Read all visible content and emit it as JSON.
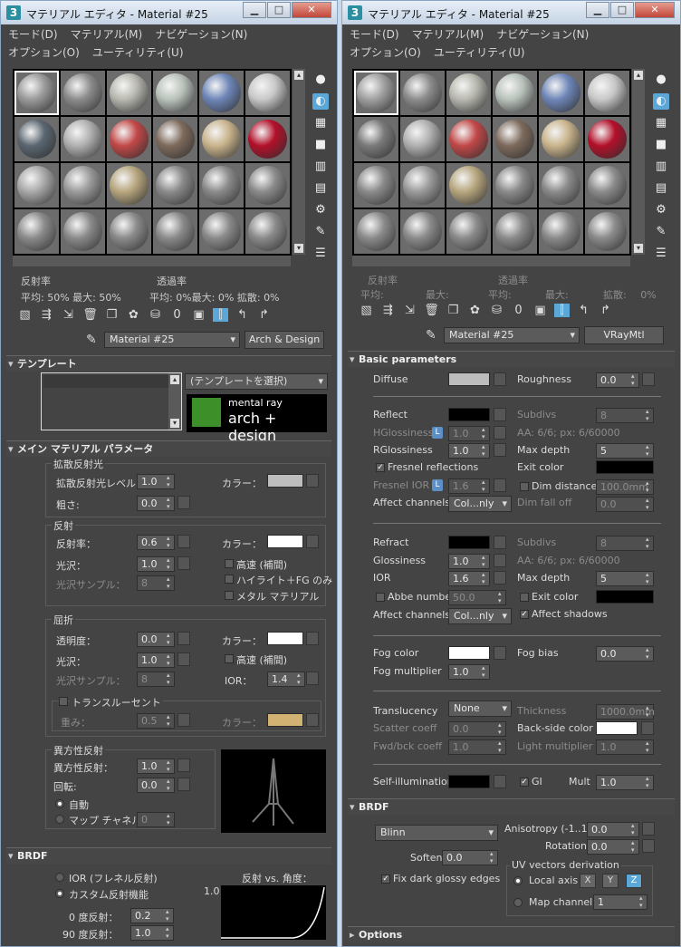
{
  "left": {
    "title": "マテリアル エディタ - Material #25",
    "menu": [
      "モード(D)",
      "マテリアル(M)",
      "ナビゲーション(N)",
      "オプション(O)",
      "ユーティリティ(U)"
    ],
    "info": {
      "reflect": "反射率",
      "transmit": "透過率",
      "avg1": "平均:",
      "avg1_val": "50%",
      "max1": "最大:",
      "max1_val": "50%",
      "avg2": "平均:",
      "avg2_val": "0%",
      "max2": "最大:",
      "max2_val": "0%",
      "diffuse": "拡散:",
      "diffuse_val": "0%"
    },
    "material_name": "Material #25",
    "material_type": "Arch & Design",
    "template": {
      "heading": "テンプレート",
      "select": "(テンプレートを選択)",
      "brand_small": "mental ray",
      "brand_big": "arch + design"
    },
    "main": {
      "heading": "メイン マテリアル パラメータ",
      "diffuse": {
        "title": "拡散反射光",
        "level_label": "拡散反射光レベル",
        "level": "1.0",
        "color_label": "カラー：",
        "rough_label": "粗さ:",
        "rough": "0.0"
      },
      "reflection": {
        "title": "反射",
        "refl_label": "反射率：",
        "refl": "0.6",
        "color_label": "カラー：",
        "gloss_label": "光沢：",
        "gloss": "1.0",
        "samples_label": "光沢サンプル：",
        "samples": "8",
        "fast": "高速 (補間)",
        "highlight": "ハイライト＋FG のみ",
        "metal": "メタル マテリアル"
      },
      "refraction": {
        "title": "屈折",
        "trans_label": "透明度：",
        "trans": "0.0",
        "color_label": "カラー：",
        "gloss_label": "光沢：",
        "gloss": "1.0",
        "samples_label": "光沢サンプル：",
        "samples": "8",
        "fast": "高速 (補間)",
        "ior_label": "IOR：",
        "ior": "1.4",
        "translucency": "トランスルーセント",
        "weight_label": "重み：",
        "weight": "0.5",
        "color2_label": "カラー："
      },
      "aniso": {
        "title": "異方性反射",
        "aniso_label": "異方性反射：",
        "aniso": "1.0",
        "rot_label": "回転:",
        "rot": "0.0",
        "auto": "自動",
        "map_ch": "マップ チャネル",
        "map_ch_val": "0"
      }
    },
    "brdf": {
      "heading": "BRDF",
      "ior_opt": "IOR (フレネル反射)",
      "custom_opt": "カスタム反射機能",
      "graph_title": "反射 vs. 角度：",
      "graph_y": "1.0",
      "deg0": "0 度反射：",
      "deg0_val": "0.2",
      "deg90": "90 度反射：",
      "deg90_val": "1.0"
    }
  },
  "right": {
    "title": "マテリアル エディタ - Material #25",
    "menu": [
      "モード(D)",
      "マテリアル(M)",
      "ナビゲーション(N)",
      "オプション(O)",
      "ユーティリティ(U)"
    ],
    "info": {
      "reflect": "反射率",
      "transmit": "透過率",
      "avg1": "平均:",
      "max1": "最大:",
      "avg2": "平均:",
      "max2": "最大:",
      "diffuse": "拡散:",
      "diffuse_val": "0%"
    },
    "material_name": "Material #25",
    "material_type": "VRayMtl",
    "basic": {
      "heading": "Basic parameters",
      "diffuse": "Diffuse",
      "roughness": "Roughness",
      "roughness_val": "0.0",
      "reflect": "Reflect",
      "subdivs": "Subdivs",
      "subdivs_val": "8",
      "hgloss": "HGlossiness",
      "hgloss_val": "1.0",
      "aa": "AA: 6/6; px: 6/60000",
      "rgloss": "RGlossiness",
      "rgloss_val": "1.0",
      "maxdepth": "Max depth",
      "maxdepth_val": "5",
      "fresnel": "Fresnel reflections",
      "exitcolor": "Exit color",
      "fresnel_ior": "Fresnel IOR",
      "fresnel_ior_val": "1.6",
      "dimdist": "Dim distance",
      "dimdist_val": "100.0mm",
      "affect": "Affect channels",
      "affect_val": "Col...nly",
      "dimfall": "Dim fall off",
      "dimfall_val": "0.0",
      "refract": "Refract",
      "rsubdivs": "Subdivs",
      "rsubdivs_val": "8",
      "gloss": "Glossiness",
      "gloss_val": "1.0",
      "raa": "AA: 6/6; px: 6/60000",
      "ior": "IOR",
      "ior_val": "1.6",
      "rmaxdepth": "Max depth",
      "rmaxdepth_val": "5",
      "abbe": "Abbe number",
      "abbe_val": "50.0",
      "rexit": "Exit color",
      "raffect": "Affect channels",
      "raffect_val": "Col...nly",
      "shadows": "Affect shadows",
      "fogcolor": "Fog color",
      "fogbias": "Fog bias",
      "fogbias_val": "0.0",
      "fogmult": "Fog multiplier",
      "fogmult_val": "1.0",
      "transl": "Translucency",
      "transl_val": "None",
      "thick": "Thickness",
      "thick_val": "1000.0mm",
      "scatter": "Scatter coeff",
      "scatter_val": "0.0",
      "backside": "Back-side color",
      "fwd": "Fwd/bck coeff",
      "fwd_val": "1.0",
      "lightmult": "Light multiplier",
      "lightmult_val": "1.0",
      "selfillum": "Self-illumination",
      "gi": "GI",
      "mult": "Mult",
      "mult_val": "1.0"
    },
    "brdf": {
      "heading": "BRDF",
      "type": "Blinn",
      "aniso": "Anisotropy (-1..1)",
      "aniso_val": "0.0",
      "rotation": "Rotation",
      "rotation_val": "0.0",
      "soften": "Soften",
      "soften_val": "0.0",
      "uvtitle": "UV vectors derivation",
      "fixdark": "Fix dark glossy edges",
      "localaxis": "Local axis",
      "x": "X",
      "y": "Y",
      "z": "Z",
      "mapch": "Map channel",
      "mapch_val": "1"
    },
    "options": "Options"
  }
}
